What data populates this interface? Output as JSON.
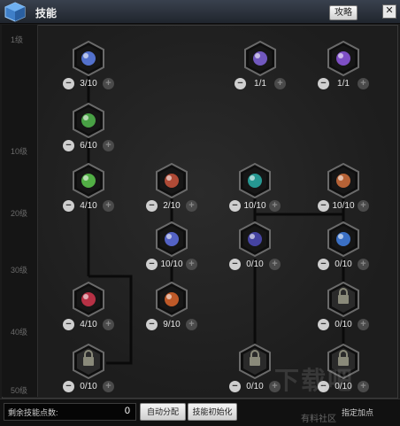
{
  "window": {
    "title": "技能",
    "guide_button": "攻略",
    "close_glyph": "✕"
  },
  "levels": [
    "1级",
    "10级",
    "20级",
    "30级",
    "40级",
    "50级"
  ],
  "skills": [
    {
      "id": "s1",
      "count": "3/10",
      "color": "#5a7be0",
      "locked": false
    },
    {
      "id": "s2",
      "count": "1/1",
      "color": "#7b5fd0",
      "locked": false
    },
    {
      "id": "s3",
      "count": "1/1",
      "color": "#8a55d8",
      "locked": false
    },
    {
      "id": "s4",
      "count": "6/10",
      "color": "#4fb04a",
      "locked": false
    },
    {
      "id": "s5",
      "count": "4/10",
      "color": "#59c04a",
      "locked": false
    },
    {
      "id": "s6",
      "count": "2/10",
      "color": "#c0503a",
      "locked": false
    },
    {
      "id": "s7",
      "count": "10/10",
      "color": "#28a6a0",
      "locked": false
    },
    {
      "id": "s8",
      "count": "10/10",
      "color": "#c86a3a",
      "locked": false
    },
    {
      "id": "s9",
      "count": "10/10",
      "color": "#5a6ad8",
      "locked": false
    },
    {
      "id": "s10",
      "count": "0/10",
      "color": "#4a48b0",
      "locked": false
    },
    {
      "id": "s11",
      "count": "0/10",
      "color": "#3f7ad8",
      "locked": false
    },
    {
      "id": "s12",
      "count": "4/10",
      "color": "#c8344a",
      "locked": false
    },
    {
      "id": "s13",
      "count": "9/10",
      "color": "#d0602a",
      "locked": false
    },
    {
      "id": "s14",
      "count": "0/10",
      "color": "#2e3a40",
      "locked": true
    },
    {
      "id": "s15",
      "count": "0/10",
      "color": "#3a3a30",
      "locked": true
    },
    {
      "id": "s16",
      "count": "0/10",
      "color": "#3a3020",
      "locked": true
    },
    {
      "id": "s17",
      "count": "0/10",
      "color": "#252a40",
      "locked": true
    }
  ],
  "footer": {
    "remaining_label": "剩余技能点数:",
    "remaining_value": "0",
    "auto_assign": "自动分配",
    "reset": "技能初始化",
    "designate": "指定加点"
  },
  "watermark": {
    "line1": "下载吧",
    "line2": "有料社区"
  }
}
